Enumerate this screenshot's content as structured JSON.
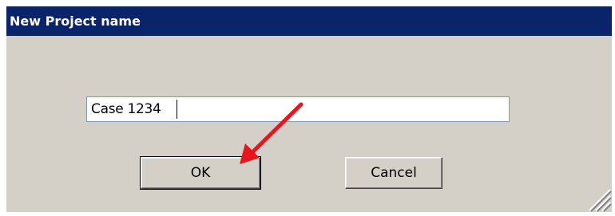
{
  "dialog": {
    "title": "New Project name",
    "input_value": "Case 1234",
    "ok_label": "OK",
    "cancel_label": "Cancel"
  },
  "colors": {
    "titlebar": "#0a246a",
    "dialog_bg": "#d4d0c8",
    "annotation_arrow": "#e8141e"
  },
  "icons": {
    "resize_grip": "resize-grip-icon",
    "annotation": "red-arrow-icon"
  }
}
